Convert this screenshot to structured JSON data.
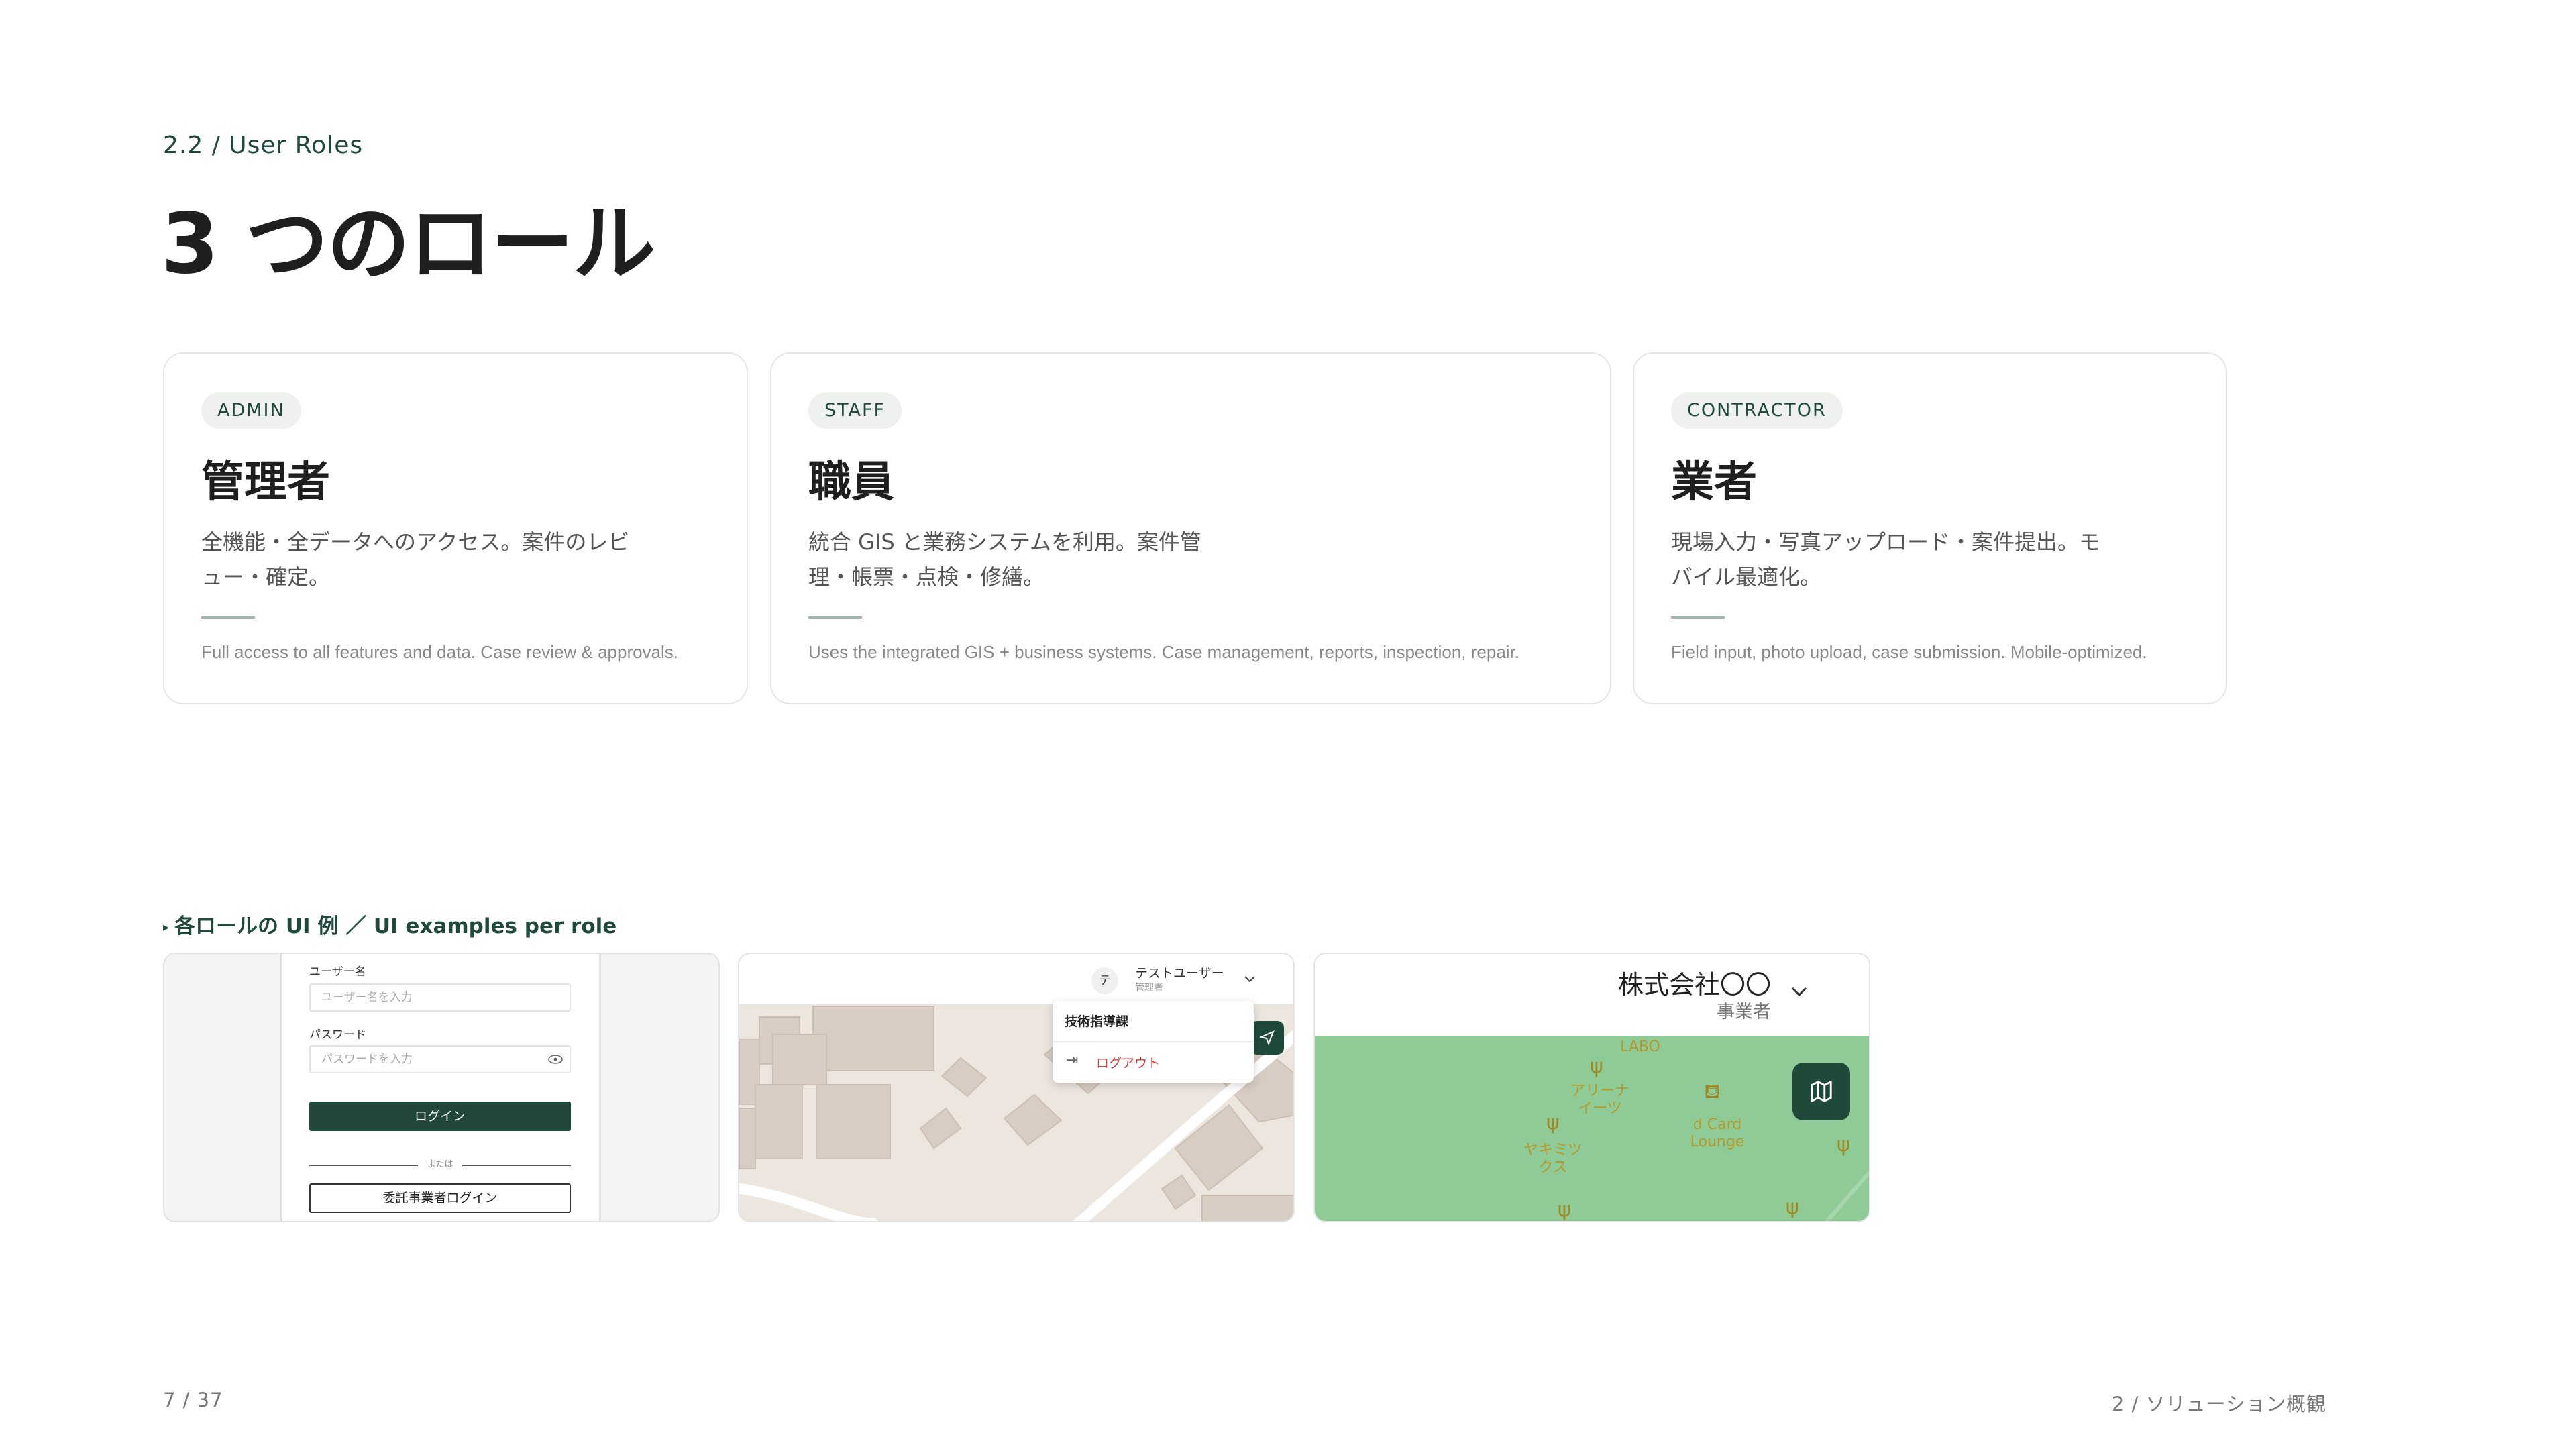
{
  "header": {
    "eyebrow": "2.2 / User Roles",
    "title": "3 つのロール"
  },
  "roles": [
    {
      "badge": "ADMIN",
      "name": "管理者",
      "desc": "全機能・全データへのアクセス。案件のレビュー・確定。",
      "desc_en": "Full access to all features and data. Case review & approvals."
    },
    {
      "badge": "STAFF",
      "name": "職員",
      "desc": "統合 GIS と業務システムを利用。案件管理・帳票・点検・修繕。",
      "desc_en": "Uses the integrated GIS + business systems. Case management, reports, inspection, repair."
    },
    {
      "badge": "CONTRACTOR",
      "name": "業者",
      "desc": "現場入力・写真アップロード・案件提出。モバイル最適化。",
      "desc_en": "Field input, photo upload, case submission. Mobile-optimized."
    }
  ],
  "examples": {
    "label": "各ロールの UI 例 ／ UI examples per role",
    "login": {
      "username_label": "ユーザー名",
      "username_placeholder": "ユーザー名を入力",
      "password_label": "パスワード",
      "password_placeholder": "パスワードを入力",
      "login_button": "ログイン",
      "or_text": "または",
      "contractor_login_button": "委託事業者ログイン"
    },
    "staff_map": {
      "avatar_initial": "テ",
      "user_name": "テストユーザー",
      "user_role": "管理者",
      "menu_department": "技術指導課",
      "menu_logout": "ログアウト"
    },
    "contractor": {
      "company_name": "株式会社〇〇",
      "company_role": "事業者",
      "pois": [
        "LABO",
        "アリーナ イーツ",
        "d Card Lounge",
        "ヤキミツ クス"
      ]
    }
  },
  "footer": {
    "page": "7 / 37",
    "section": "2 / ソリューション概観"
  },
  "colors": {
    "accent": "#1f4a3a",
    "map_green": "#8ecb97",
    "logout_red": "#d23b3b"
  }
}
